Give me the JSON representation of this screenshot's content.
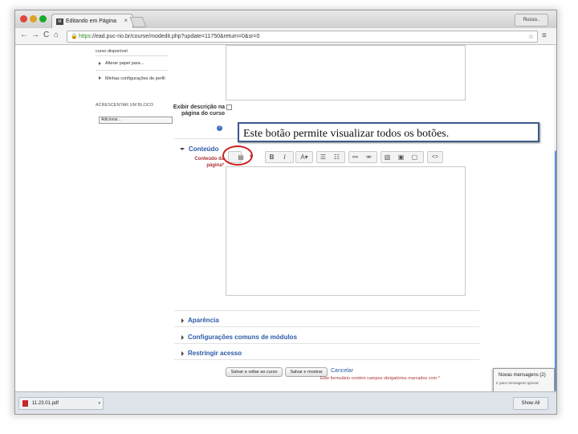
{
  "browser": {
    "tab_title": "Editando em Página",
    "tab_close": "×",
    "profile": "Russo..",
    "url_https": "https",
    "url_rest": "://ead.puc-rio.br/course/modedit.php?update=11750&return=0&sr=0",
    "lock_icon": "🔒",
    "back": "←",
    "forward": "→",
    "reload": "C",
    "home": "⌂",
    "star": "☆",
    "menu": "≡"
  },
  "sidebar": {
    "items": [
      "curso disponível",
      "Alterar papel para...",
      "Minhas configurações de perfil"
    ],
    "block_heading": "ACRESCENTAR UM BLOCO",
    "select_value": "Adicionar..."
  },
  "form": {
    "show_description_label": "Exibir descrição na página do curso",
    "help_icon": "?",
    "content_section": "Conteúdo",
    "page_content_label": "Conteúdo da página*",
    "sections": [
      "Aparência",
      "Configurações comuns de módulos",
      "Restringir acesso"
    ],
    "save_return": "Salvar e voltar ao curso",
    "save_show": "Salvar e mostrar",
    "cancel": "Cancelar",
    "required_note": "Este formulário contém campos obrigatórios marcados com *"
  },
  "editor": {
    "toolbar_toggle": "▤",
    "bold": "B",
    "italic": "I",
    "font": "A▾",
    "bullets": "☰",
    "numbers": "☷",
    "link": "⚯",
    "unlink": "⚮",
    "image": "▧",
    "media": "▣",
    "file": "▢",
    "html": "<>"
  },
  "callout": {
    "text": "Este botão permite visualizar todos os botões."
  },
  "notification": {
    "title": "Novas mensagens (2)",
    "actions": "Ir para mensagens   Ignorar"
  },
  "downloads": {
    "file": "11.23.01.pdf",
    "caret": "▾",
    "show_all": "Show All"
  },
  "colors": {
    "accent": "#2b5aa6",
    "highlight_circle": "#cc1f1f",
    "scroll_thumb": "#5a8fd8"
  }
}
